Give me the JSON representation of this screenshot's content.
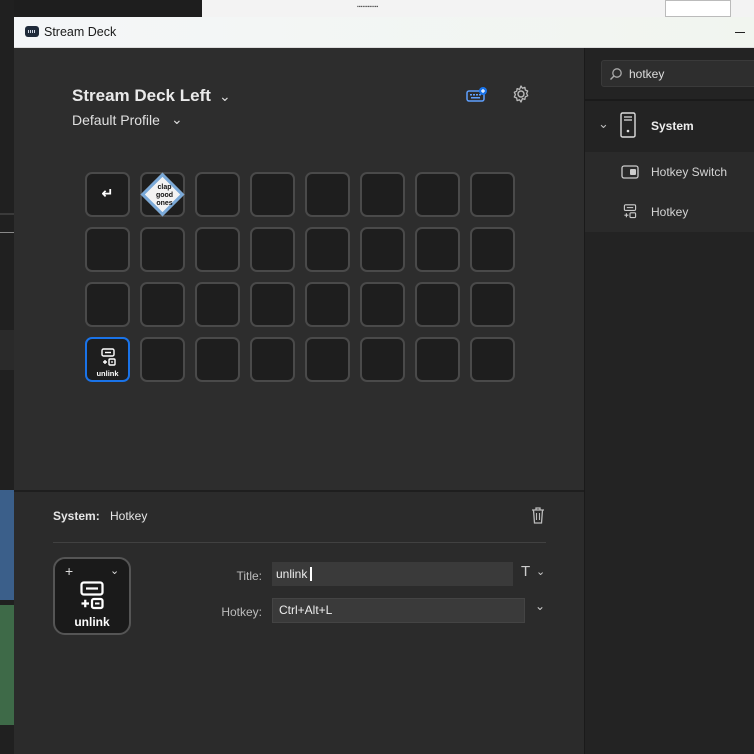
{
  "window": {
    "title": "Stream Deck"
  },
  "header": {
    "device_name": "Stream Deck Left",
    "profile_name": "Default Profile"
  },
  "grid": {
    "rows": 4,
    "cols": 8,
    "keys": [
      {
        "row": 0,
        "col": 0,
        "type": "back",
        "glyph": "↵"
      },
      {
        "row": 0,
        "col": 1,
        "type": "image",
        "text": "clap good ones"
      },
      {
        "row": 3,
        "col": 0,
        "type": "hotkey",
        "label": "unlink",
        "selected": true
      }
    ]
  },
  "inspector": {
    "category": "System:",
    "action": "Hotkey",
    "preview_label": "unlink",
    "title_label": "Title:",
    "title_value": "unlink",
    "hotkey_label": "Hotkey:",
    "hotkey_value": "Ctrl+Alt+L"
  },
  "sidebar": {
    "search_value": "hotkey",
    "category": "System",
    "actions": [
      {
        "label": "Hotkey Switch",
        "icon": "toggle-switch-icon"
      },
      {
        "label": "Hotkey",
        "icon": "hotkey-icon"
      }
    ]
  },
  "colors": {
    "accent": "#1a73e8",
    "panel": "#2d2d2d",
    "sidebar": "#232323"
  }
}
